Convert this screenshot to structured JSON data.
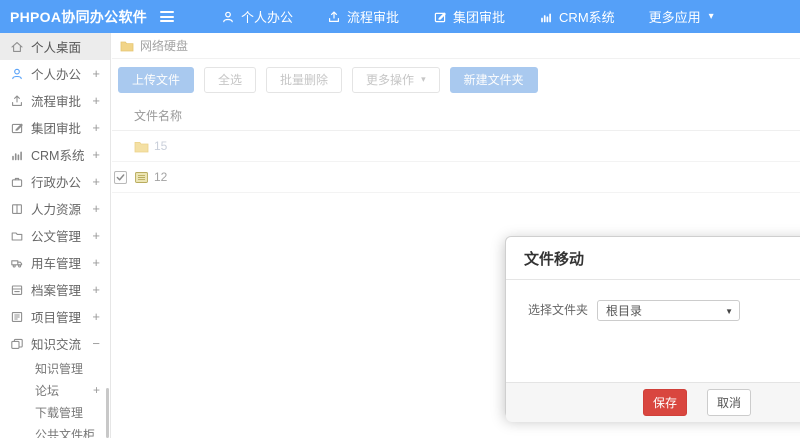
{
  "app": {
    "logo": "PHPOA协同办公软件"
  },
  "icons": {
    "caret_down": "▾",
    "select_caret": "▼"
  },
  "topnav": {
    "items": [
      {
        "label": "个人办公",
        "icon": "user-icon"
      },
      {
        "label": "流程审批",
        "icon": "upload-icon"
      },
      {
        "label": "集团审批",
        "icon": "edit-icon"
      },
      {
        "label": "CRM系统",
        "icon": "chart-icon"
      },
      {
        "label": "更多应用",
        "icon": "caret-down-icon"
      }
    ]
  },
  "sidebar": {
    "items": [
      {
        "label": "个人桌面",
        "icon": "home-icon",
        "expand": "",
        "active": true
      },
      {
        "label": "个人办公",
        "icon": "user-icon",
        "expand": "+"
      },
      {
        "label": "流程审批",
        "icon": "upload-icon",
        "expand": "+"
      },
      {
        "label": "集团审批",
        "icon": "edit-icon",
        "expand": "+"
      },
      {
        "label": "CRM系统",
        "icon": "chart-icon",
        "expand": "+"
      },
      {
        "label": "行政办公",
        "icon": "briefcase-icon",
        "expand": "+"
      },
      {
        "label": "人力资源",
        "icon": "book-icon",
        "expand": "+"
      },
      {
        "label": "公文管理",
        "icon": "document-icon",
        "expand": "+"
      },
      {
        "label": "用车管理",
        "icon": "truck-icon",
        "expand": "+"
      },
      {
        "label": "档案管理",
        "icon": "archive-icon",
        "expand": "+"
      },
      {
        "label": "项目管理",
        "icon": "project-icon",
        "expand": "+"
      },
      {
        "label": "知识交流",
        "icon": "layers-icon",
        "expand": "−"
      }
    ],
    "subitems": [
      {
        "label": "知识管理",
        "expand": ""
      },
      {
        "label": "论坛",
        "expand": "+"
      },
      {
        "label": "下载管理",
        "expand": ""
      },
      {
        "label": "公共文件柜",
        "expand": ""
      }
    ]
  },
  "breadcrumb": {
    "label": "网络硬盘"
  },
  "toolbar": {
    "upload": "上传文件",
    "select_all": "全选",
    "batch_delete": "批量删除",
    "more_ops": "更多操作",
    "new_folder": "新建文件夹"
  },
  "table": {
    "header": "文件名称",
    "rows": [
      {
        "name": "15",
        "type": "folder",
        "checked": false
      },
      {
        "name": "12",
        "type": "file",
        "checked": true
      }
    ]
  },
  "modal": {
    "title": "文件移动",
    "label": "选择文件夹",
    "select_value": "根目录",
    "save": "保存",
    "cancel": "取消"
  },
  "colors": {
    "topbar": "#55a0f8",
    "primary_button": "#a9c9ef",
    "save_button": "#d9463f",
    "active_item_bg": "#ececec",
    "folder_icon": "#f1d488"
  }
}
